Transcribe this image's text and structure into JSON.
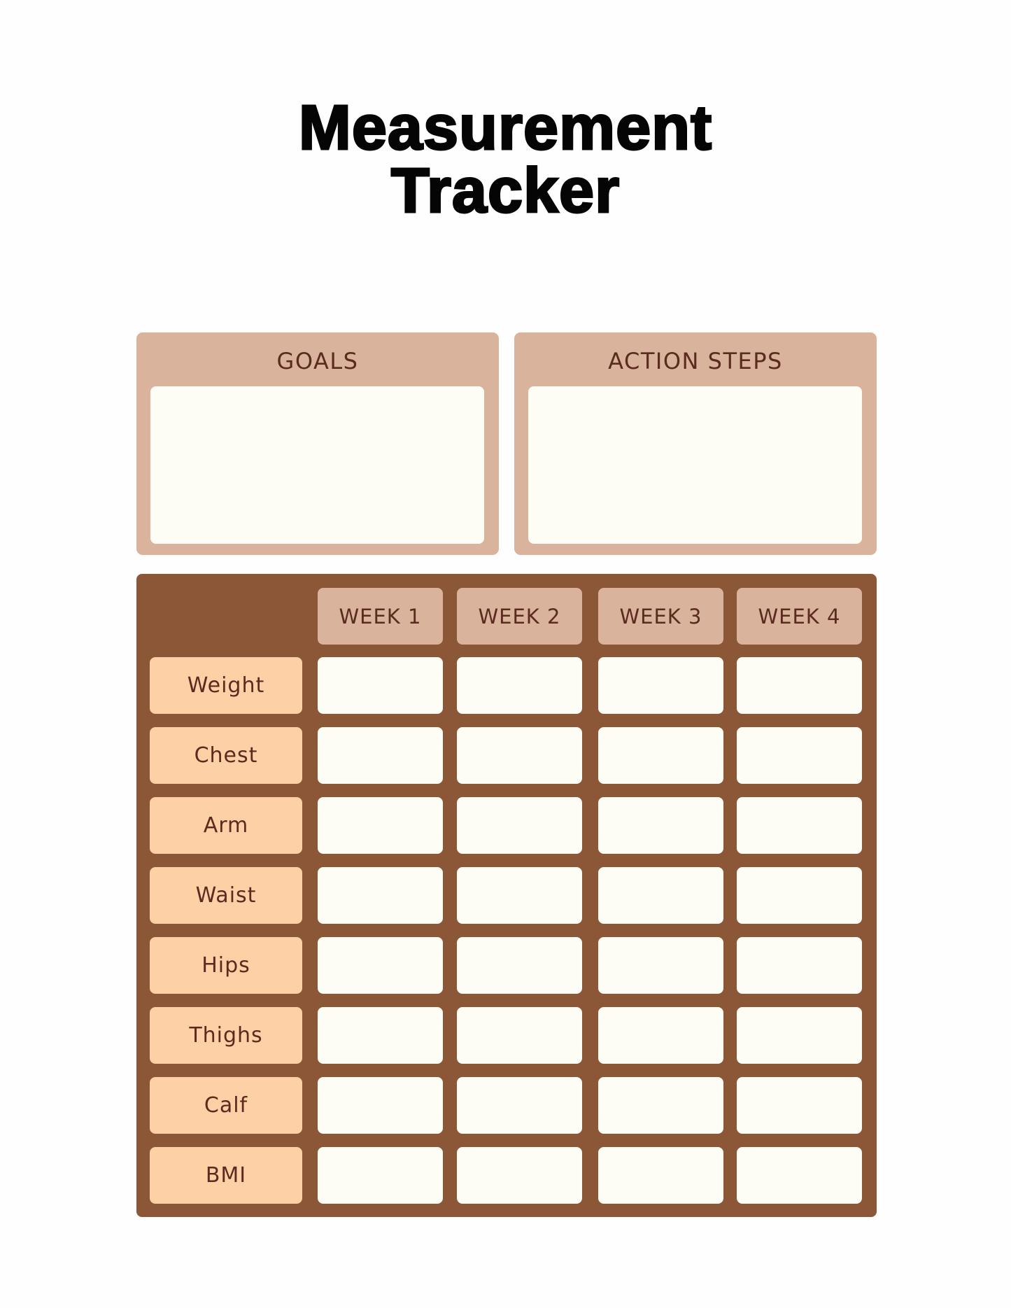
{
  "title": {
    "line1": "Measurement",
    "line2": "Tracker"
  },
  "panels": {
    "goals": {
      "label": "GOALS",
      "value": ""
    },
    "action_steps": {
      "label": "ACTION STEPS",
      "value": ""
    }
  },
  "table": {
    "columns": [
      "WEEK 1",
      "WEEK 2",
      "WEEK 3",
      "WEEK 4"
    ],
    "rows": [
      {
        "label": "Weight",
        "values": [
          "",
          "",
          "",
          ""
        ]
      },
      {
        "label": "Chest",
        "values": [
          "",
          "",
          "",
          ""
        ]
      },
      {
        "label": "Arm",
        "values": [
          "",
          "",
          "",
          ""
        ]
      },
      {
        "label": "Waist",
        "values": [
          "",
          "",
          "",
          ""
        ]
      },
      {
        "label": "Hips",
        "values": [
          "",
          "",
          "",
          ""
        ]
      },
      {
        "label": "Thighs",
        "values": [
          "",
          "",
          "",
          ""
        ]
      },
      {
        "label": "Calf",
        "values": [
          "",
          "",
          "",
          ""
        ]
      },
      {
        "label": "BMI",
        "values": [
          "",
          "",
          "",
          ""
        ]
      }
    ]
  },
  "colors": {
    "background": "#fefefe",
    "panel_tan": "#d9b39b",
    "cream": "#fdfdf5",
    "table_brown": "#8b5737",
    "label_peach": "#fed0a6",
    "text_brown": "#5a2b1e",
    "title_black": "#050505"
  }
}
